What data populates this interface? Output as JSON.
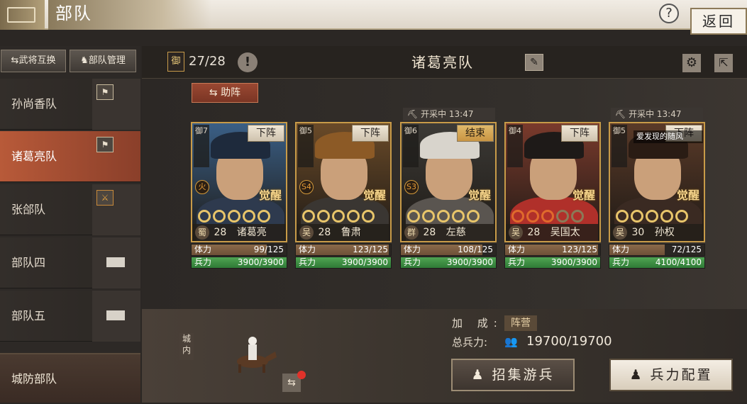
{
  "header": {
    "title": "部队",
    "back_label": "返回",
    "help_icon": "?"
  },
  "sidebar": {
    "swap_label": "⇆武将互换",
    "manage_label": "部队管理",
    "teams": [
      {
        "label": "孙尚香队",
        "icon": "team-flag-icon"
      },
      {
        "label": "诸葛亮队",
        "icon": "team-flag-icon",
        "active": true
      },
      {
        "label": "张郃队",
        "icon": "crossed-swords-icon"
      },
      {
        "label": "部队四",
        "icon": "locked-slot-icon"
      },
      {
        "label": "部队五",
        "icon": "locked-slot-icon"
      }
    ],
    "defense_label": "城防部队"
  },
  "main": {
    "defense_badge": "御",
    "defense_count": "27/28",
    "team_title": "诸葛亮队",
    "assist_label": "⇆ 助阵"
  },
  "cards": [
    {
      "name": "诸葛亮",
      "faction": "蜀",
      "level": "28",
      "def": "御7",
      "action": "下阵",
      "hp": "99/125",
      "hp_pct": 0.79,
      "troops": "3900/3900",
      "stat_hp": "体力",
      "stat_troop": "兵力",
      "awake": "觉醒",
      "trait": "火",
      "mining": "",
      "stars": [
        "gold",
        "gold",
        "gold",
        "gold",
        "gold"
      ],
      "bg": "#3a5f86",
      "robe": "#2e3a4e",
      "hair": "#1e2a3c"
    },
    {
      "name": "鲁肃",
      "faction": "吴",
      "level": "28",
      "def": "御5",
      "action": "下阵",
      "hp": "123/125",
      "hp_pct": 0.98,
      "troops": "3900/3900",
      "stat_hp": "体力",
      "stat_troop": "兵力",
      "awake": "觉醒",
      "trait": "S4",
      "mining": "",
      "stars": [
        "gold",
        "gold",
        "gold",
        "gold",
        "gold"
      ],
      "bg": "#6a4a28",
      "robe": "#3a3632",
      "hair": "#8c5a26"
    },
    {
      "name": "左慈",
      "faction": "群",
      "level": "28",
      "def": "御6",
      "action": "结束",
      "hp": "108/125",
      "hp_pct": 0.86,
      "troops": "3900/3900",
      "stat_hp": "体力",
      "stat_troop": "兵力",
      "awake": "觉醒",
      "trait": "S3",
      "mining": "开采中 13:47",
      "stars": [
        "gold",
        "gold",
        "gold",
        "gold",
        "gold"
      ],
      "bg": "#3c3a36",
      "robe": "#5a5550",
      "hair": "#d8d4cc"
    },
    {
      "name": "吴国太",
      "faction": "吴",
      "level": "28",
      "def": "御4",
      "action": "下阵",
      "hp": "123/125",
      "hp_pct": 0.98,
      "troops": "3900/3900",
      "stat_hp": "体力",
      "stat_troop": "兵力",
      "awake": "觉醒",
      "trait": "",
      "mining": "",
      "stars": [
        "red",
        "red",
        "red",
        "dim",
        "dim"
      ],
      "bg": "#7a3a2c",
      "robe": "#b0302a",
      "hair": "#1e1a18"
    },
    {
      "name": "孙权",
      "faction": "吴",
      "level": "30",
      "def": "御5",
      "action": "下阵",
      "hp": "72/125",
      "hp_pct": 0.58,
      "troops": "4100/4100",
      "stat_hp": "体力",
      "stat_troop": "兵力",
      "awake": "觉醒",
      "trait": "",
      "mining": "开采中 13:47",
      "stars": [
        "gold",
        "gold",
        "gold",
        "gold",
        "gold"
      ],
      "bg": "#5a3a28",
      "robe": "#3a2a22",
      "hair": "#2a1c14"
    }
  ],
  "watermark": "爱发现的随风",
  "bottom": {
    "city_label": "城内",
    "bonus_label": "加 成:",
    "bonus_tag": "阵营",
    "total_label": "总兵力:",
    "total_value": "19700/19700",
    "recruit_label": "招集游兵",
    "troop_label": "兵力配置"
  }
}
